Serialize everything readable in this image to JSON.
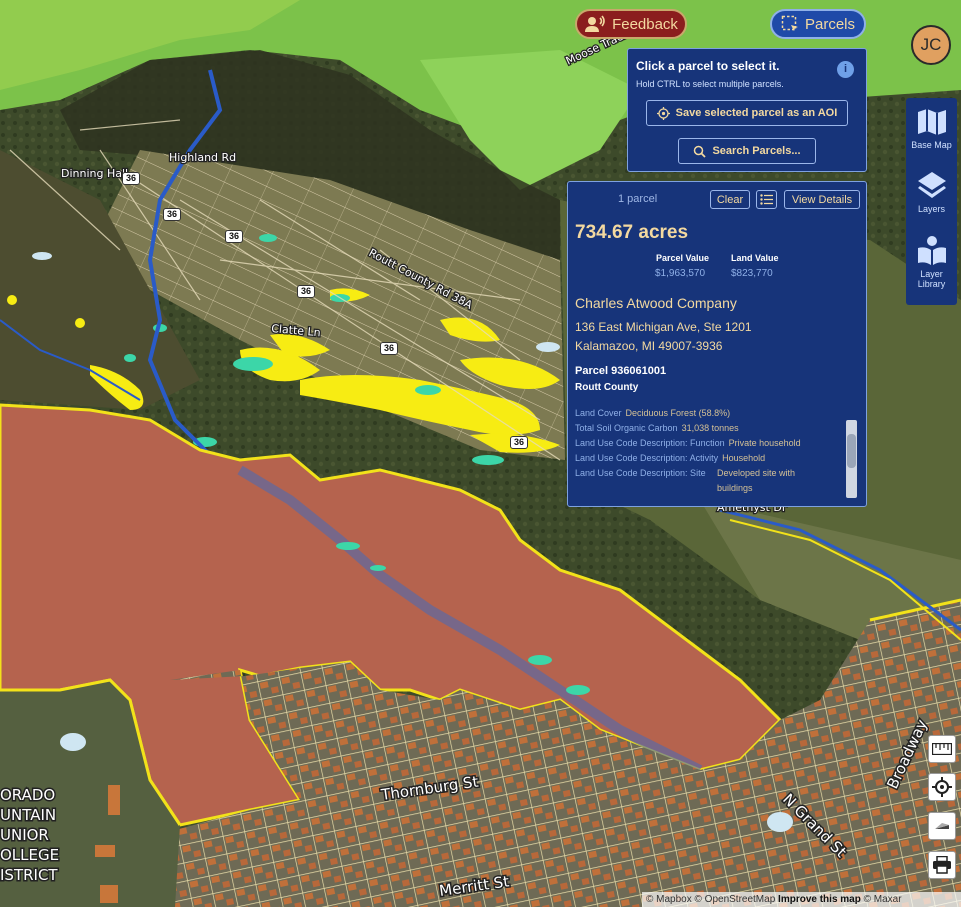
{
  "topbar": {
    "feedback_label": "Feedback",
    "parcels_label": "Parcels",
    "avatar_initials": "JC"
  },
  "select_panel": {
    "title": "Click a parcel to select it.",
    "subtitle": "Hold CTRL to select multiple parcels.",
    "save_aoi_label": "Save selected parcel as an AOI",
    "search_label": "Search Parcels..."
  },
  "right_toolbar": {
    "items": [
      {
        "label_line1": "Base Map",
        "label_line2": "",
        "icon": "map-icon"
      },
      {
        "label_line1": "Layers",
        "label_line2": "",
        "icon": "layers-icon"
      },
      {
        "label_line1": "Layer",
        "label_line2": "Library",
        "icon": "library-icon"
      }
    ]
  },
  "parcel_panel": {
    "count_text": "1 parcel",
    "clear_label": "Clear",
    "details_label": "View Details",
    "acres": "734.67 acres",
    "parcel_value_label": "Parcel Value",
    "parcel_value": "$1,963,570",
    "land_value_label": "Land Value",
    "land_value": "$823,770",
    "owner": "Charles Atwood Company",
    "address_line1": "136 East Michigan Ave, Ste 1201",
    "address_line2": "Kalamazoo, MI 49007-3936",
    "parcel_number": "Parcel 936061001",
    "county": "Routt County",
    "attributes": [
      {
        "key": "Land Cover",
        "value": "Deciduous Forest  (58.8%)"
      },
      {
        "key": "Total Soil Organic Carbon",
        "value": "31,038 tonnes"
      },
      {
        "key": "Land Use Code Description: Function",
        "value": "Private household"
      },
      {
        "key": "Land Use Code Description: Activity",
        "value": "Household"
      },
      {
        "key": "Land Use Code Description: Site",
        "value": "Developed site with buildings"
      }
    ]
  },
  "map_labels": {
    "dinning_hall": "Dinning Hall",
    "highland_rd": "Highland Rd",
    "routt_county_rd": "Routt County Rd 38A",
    "clatte_ln": "Clatte Ln",
    "amethyst_dr": "Amethyst Dr",
    "thornburg_st": "Thornburg St",
    "n_grand_st": "N Grand St",
    "merritt_st": "Merritt St",
    "broadway": "Broadway",
    "moose_track_ln": "Moose Track Ln",
    "college_label": "ORADO MTAIN NIOR LLEGE STRICT",
    "college_lines": [
      "ORADO",
      "UNTAIN",
      "UNIOR",
      "OLLEGE",
      "ISTRICT"
    ],
    "route_shield": "36"
  },
  "attribution": {
    "mapbox": "© Mapbox",
    "osm": "© OpenStreetMap",
    "improve": "Improve this map",
    "maxar": "© Maxar"
  },
  "colors": {
    "panel_bg": "#17347a",
    "accent_gold": "#f3d9a0",
    "parcel_fill": "#b5634e",
    "parcel_outline": "#f2e21a",
    "feedback_red": "#8b1e1e"
  }
}
